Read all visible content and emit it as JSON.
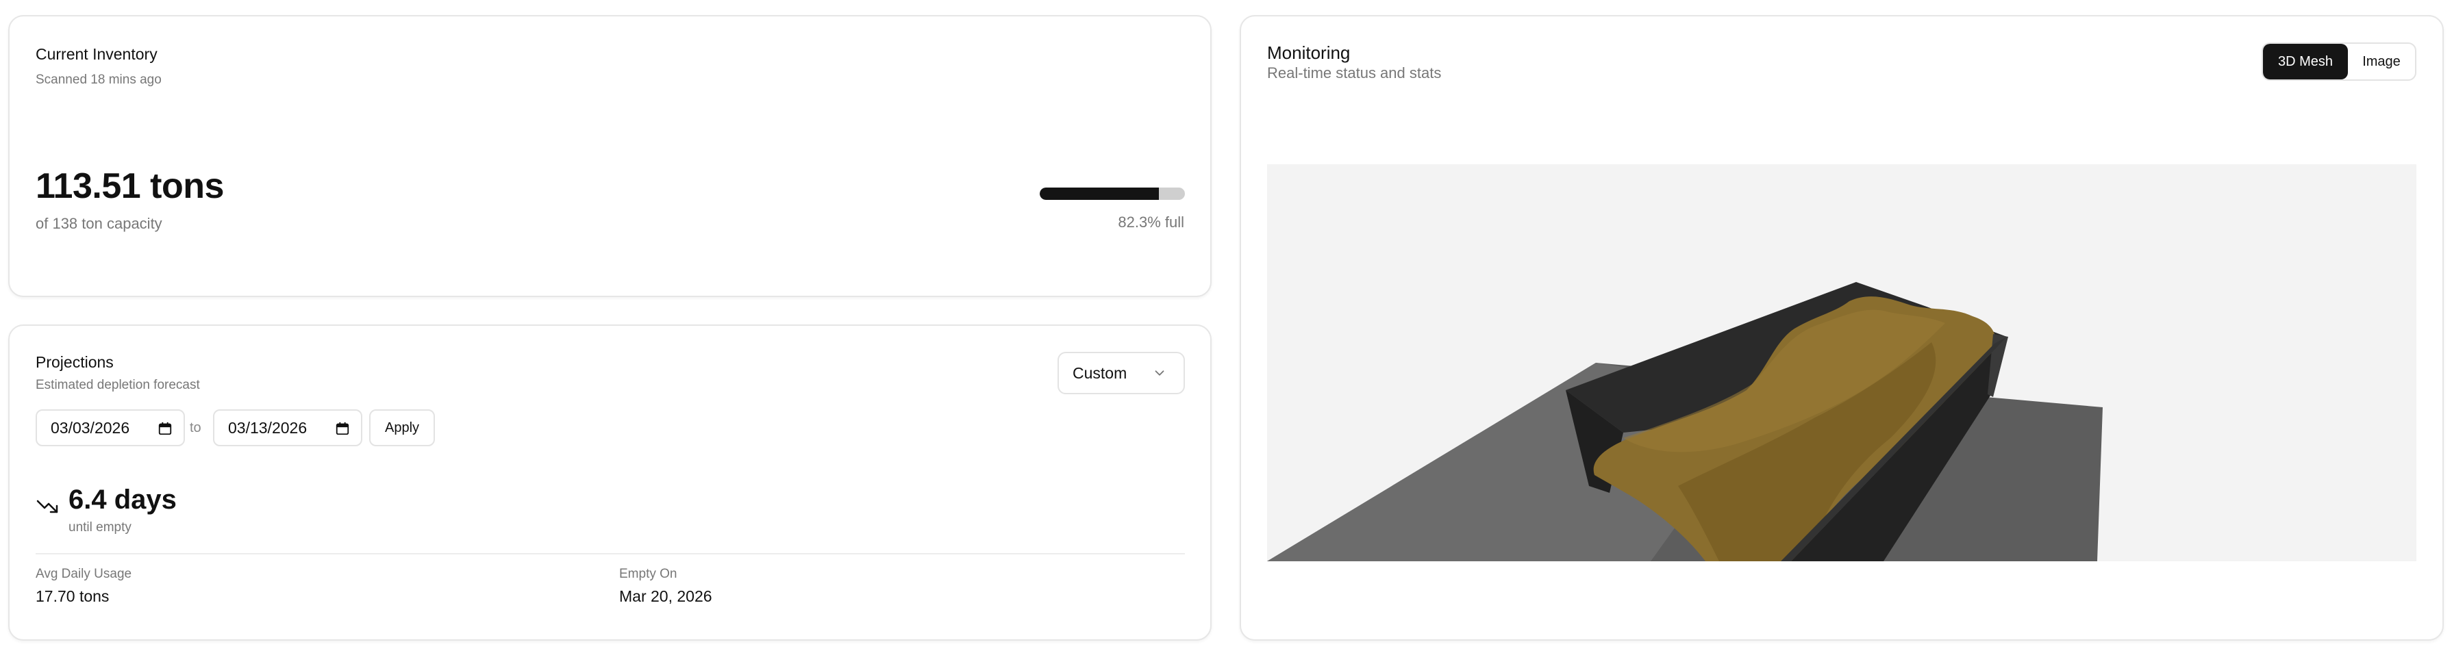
{
  "inventory": {
    "title": "Current Inventory",
    "scanned": "Scanned 18 mins ago",
    "amount": "113.51 tons",
    "capacity": "of 138 ton capacity",
    "fill_percent": 82.3,
    "fill_label": "82.3% full"
  },
  "projections": {
    "title": "Projections",
    "subtitle": "Estimated depletion forecast",
    "range_selected": "Custom",
    "date_from": "03/03/2026",
    "to_label": "to",
    "date_to": "03/13/2026",
    "apply_label": "Apply",
    "days_value": "6.4 days",
    "days_sub": "until empty",
    "avg_label": "Avg Daily Usage",
    "avg_value": "17.70 tons",
    "empty_label": "Empty On",
    "empty_value": "Mar 20, 2026"
  },
  "monitoring": {
    "title": "Monitoring",
    "subtitle": "Real-time status and stats",
    "view_options": [
      "3D Mesh",
      "Image"
    ],
    "active_view": "3D Mesh"
  },
  "colors": {
    "accent_dark": "#141414",
    "bar_track": "#cfcfcf",
    "material": "#8a6e2e",
    "bin_wall": "#2b2b2b",
    "ground": "#5a5a5a",
    "viewport_bg": "#f3f3f3"
  },
  "icons": {
    "range_dropdown": "chevron-down-icon",
    "date_picker": "calendar-icon",
    "trend": "trending-down-icon"
  }
}
